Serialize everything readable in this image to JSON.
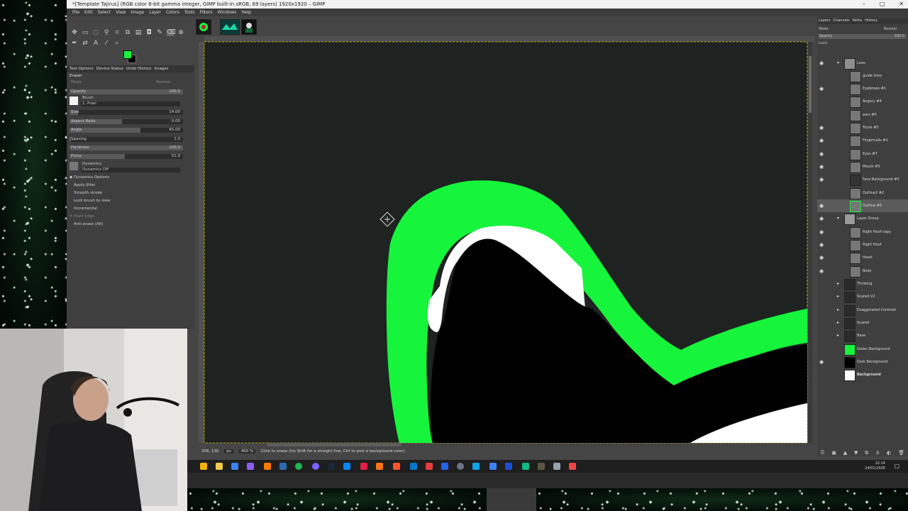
{
  "window": {
    "title": "*[Template Tajirus] (RGB color 8-bit gamma integer, GIMP built-in sRGB, 69 layers) 1920x1920 – GIMP",
    "controls": [
      "–",
      "□",
      "✕"
    ]
  },
  "menubar": [
    "File",
    "Edit",
    "Select",
    "View",
    "Image",
    "Layer",
    "Colors",
    "Tools",
    "Filters",
    "Windows",
    "Help"
  ],
  "colors": {
    "foreground": "#16f53c",
    "background": "#000000",
    "accent": "#16f53c"
  },
  "tool_options": {
    "tabs": [
      "Tool Options",
      "Device Status",
      "Undo History",
      "Images"
    ],
    "tool_name": "Eraser",
    "mode_label": "Mode",
    "mode_value": "Normal",
    "opacity": {
      "label": "Opacity",
      "value": "100.0"
    },
    "brush": {
      "label": "Brush",
      "value": "1. Pixel"
    },
    "sliders": [
      {
        "label": "Size",
        "value": "14.00"
      },
      {
        "label": "Aspect Ratio",
        "value": "0.00"
      },
      {
        "label": "Angle",
        "value": "45.00"
      },
      {
        "label": "Spacing",
        "value": "1.0"
      },
      {
        "label": "Hardness",
        "value": "100.0"
      },
      {
        "label": "Force",
        "value": "51.0"
      }
    ],
    "dynamics": {
      "label": "Dynamics",
      "value": "Dynamics Off"
    },
    "checkboxes": [
      "Dynamics Options",
      "Apply Jitter",
      "Smooth stroke",
      "Lock brush to view",
      "Incremental",
      "Hard edge",
      "Anti erase  (Alt)"
    ]
  },
  "status": {
    "coords": "306, 130",
    "unit": "px",
    "zoom": "400 %",
    "message": "Click to erase (try Shift for a straight line, Ctrl to pick a background color)"
  },
  "layers_panel": {
    "tabs": [
      "Layers",
      "Channels",
      "Paths",
      "History"
    ],
    "mode_label": "Mode",
    "mode_value": "Normal",
    "opacity_label": "Opacity",
    "opacity_value": "100.0",
    "lock_label": "Lock:",
    "layers": [
      {
        "name": "Love",
        "visible": true
      },
      {
        "name": "guide lines",
        "visible": false
      },
      {
        "name": "Eyebrows #1",
        "visible": true
      },
      {
        "name": "Angery #4",
        "visible": false
      },
      {
        "name": "ears #5",
        "visible": false
      },
      {
        "name": "Trunk #5",
        "visible": true
      },
      {
        "name": "Fingernails #1",
        "visible": true
      },
      {
        "name": "Eyes #7",
        "visible": true
      },
      {
        "name": "Mouth #5",
        "visible": true
      },
      {
        "name": "Face Background #5",
        "visible": true
      },
      {
        "name": "Outline2 #2",
        "visible": false
      },
      {
        "name": "Outline #5",
        "visible": true
      },
      {
        "name": "Layer Group",
        "visible": true
      },
      {
        "name": "Right Hoof copy",
        "visible": true
      },
      {
        "name": "Right Hoof",
        "visible": true
      },
      {
        "name": "Heart",
        "visible": true
      },
      {
        "name": "Body",
        "visible": true
      },
      {
        "name": "Thinking",
        "visible": false
      },
      {
        "name": "Scared V2",
        "visible": false
      },
      {
        "name": "Exaggerated Contrast",
        "visible": false
      },
      {
        "name": "Scared",
        "visible": false
      },
      {
        "name": "Base",
        "visible": false
      },
      {
        "name": "Green Background",
        "visible": false
      },
      {
        "name": "Dark Background",
        "visible": true
      },
      {
        "name": "Background",
        "visible": false
      }
    ]
  },
  "taskbar": {
    "time": "22:14",
    "date": "24/01/2026"
  }
}
